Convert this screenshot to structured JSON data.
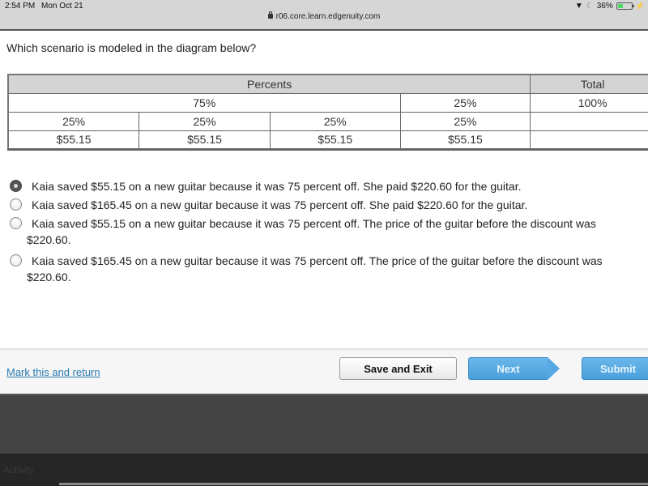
{
  "status_bar": {
    "time": "2:54 PM",
    "date": "Mon Oct 21",
    "url": "r06.core.learn.edgenuity.com",
    "battery_percent": "36%",
    "battery_level": 0.36,
    "icons": [
      "wifi-icon",
      "moon-icon",
      "battery-icon",
      "charging-icon",
      "lock-icon"
    ]
  },
  "question": {
    "prompt": "Which scenario is modeled in the diagram below?"
  },
  "diagram": {
    "header": {
      "percents": "Percents",
      "total": "Total"
    },
    "row1": {
      "group_a": "75%",
      "group_b": "25%",
      "total": "100%"
    },
    "row2": [
      "25%",
      "25%",
      "25%",
      "25%",
      ""
    ],
    "row3": [
      "$55.15",
      "$55.15",
      "$55.15",
      "$55.15",
      ""
    ]
  },
  "options": [
    {
      "line1": "Kaia saved $55.15 on a new guitar because it was 75 percent off. She paid $220.60 for the guitar.",
      "line2": "",
      "selected": true
    },
    {
      "line1": "Kaia saved $165.45 on a new guitar because it was 75 percent off. She paid $220.60 for the guitar.",
      "line2": "",
      "selected": false
    },
    {
      "line1": "Kaia saved $55.15 on a new guitar because it was 75 percent off. The price of the guitar before the discount was",
      "line2": "$220.60.",
      "selected": false
    },
    {
      "line1": "Kaia saved $165.45 on a new guitar because it was 75 percent off. The price of the guitar before the discount was",
      "line2": "$220.60.",
      "selected": false
    }
  ],
  "footer": {
    "mark_link": "Mark this and return",
    "save_exit": "Save and Exit",
    "next": "Next",
    "submit": "Submit"
  },
  "bottom_panel": {
    "activity_label": "Activity"
  }
}
